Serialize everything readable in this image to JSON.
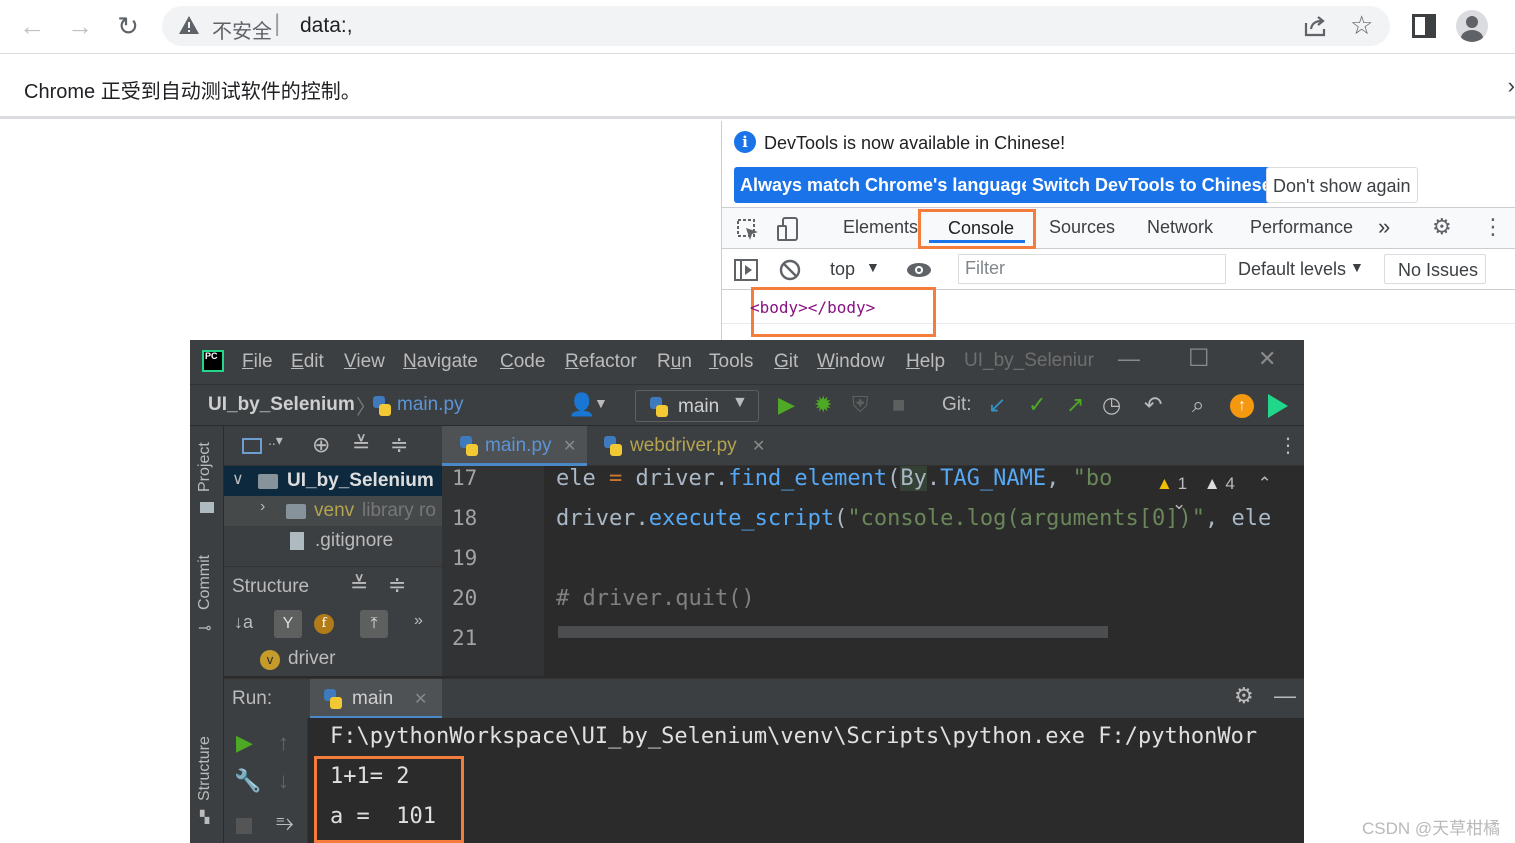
{
  "browser": {
    "security_label": "不安全",
    "url": "data:,",
    "automation_notice": "Chrome 正受到自动测试软件的控制。"
  },
  "devtools": {
    "banner_text": "DevTools is now available in Chinese!",
    "banner_buttons": [
      "Always match Chrome's language",
      "Switch DevTools to Chinese",
      "Don't show again"
    ],
    "tabs": [
      "Elements",
      "Console",
      "Sources",
      "Network",
      "Performance"
    ],
    "active_tab": "Console",
    "context": "top",
    "filter_placeholder": "Filter",
    "levels": "Default levels",
    "issues": "No Issues",
    "log_line": "<body></body>"
  },
  "pycharm": {
    "menu": [
      "File",
      "Edit",
      "View",
      "Navigate",
      "Code",
      "Refactor",
      "Run",
      "Tools",
      "Git",
      "Window",
      "Help"
    ],
    "window_title": "UI_by_Seleniur",
    "project_name": "UI_by_Selenium",
    "current_file": "main.py",
    "run_config": "main",
    "git_label": "Git:",
    "tool_windows": {
      "project": "Project",
      "commit": "Commit",
      "structure": "Structure"
    },
    "editor_tabs": [
      {
        "name": "main.py",
        "active": true
      },
      {
        "name": "webdriver.py",
        "active": false
      }
    ],
    "tree": {
      "root": "UI_by_Selenium",
      "venv": "venv",
      "venv_note": "library ro",
      "gitignore": ".gitignore"
    },
    "structure_title": "Structure",
    "structure_item": "driver",
    "structure_item_badge": "v",
    "inspection_warn1": "1",
    "inspection_warn2": "4",
    "code_lines": [
      {
        "no": "17",
        "text": "ele = driver.find_element(By.TAG_NAME, \"bo"
      },
      {
        "no": "18",
        "text": "driver.execute_script(\"console.log(arguments[0])\", ele"
      },
      {
        "no": "19",
        "text": ""
      },
      {
        "no": "20",
        "text": "# driver.quit()"
      },
      {
        "no": "21",
        "text": ""
      }
    ],
    "run_label": "Run:",
    "run_tab": "main",
    "console_lines": [
      "F:\\pythonWorkspace\\UI_by_Selenium\\venv\\Scripts\\python.exe F:/pythonWor",
      "1+1= 2",
      "a =  101"
    ]
  },
  "watermark": "CSDN @天草柑橘"
}
